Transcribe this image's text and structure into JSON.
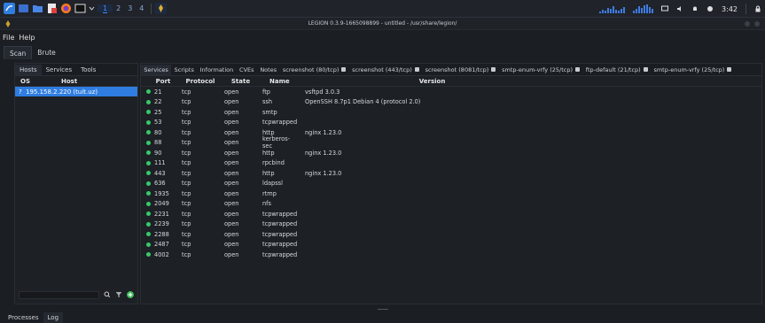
{
  "taskbar": {
    "workspaces": [
      "1",
      "2",
      "3",
      "4"
    ],
    "active_workspace": "1",
    "clock": "3:42",
    "app_icons": [
      "kali-menu-icon",
      "show-desktop-icon",
      "file-manager-icon",
      "text-editor-icon",
      "firefox-icon",
      "terminal-icon",
      "dropdown-icon"
    ]
  },
  "window": {
    "title": "LEGION 0.3.9-1665098899 - untitled - /usr/share/legion/"
  },
  "menubar": {
    "file": "File",
    "help": "Help"
  },
  "mode_tabs": {
    "scan": "Scan",
    "brute": "Brute"
  },
  "left_panel": {
    "tabs": [
      "Hosts",
      "Services",
      "Tools"
    ],
    "columns": {
      "os": "OS",
      "host": "Host"
    },
    "hosts": [
      {
        "os": "?",
        "host": "195.158.2.220 (tuit.uz)"
      }
    ]
  },
  "right_panel": {
    "tabs": [
      {
        "label": "Services",
        "closable": false
      },
      {
        "label": "Scripts",
        "closable": false
      },
      {
        "label": "Information",
        "closable": false
      },
      {
        "label": "CVEs",
        "closable": false
      },
      {
        "label": "Notes",
        "closable": false
      },
      {
        "label": "screenshot (80/tcp)",
        "closable": true
      },
      {
        "label": "screenshot (443/tcp)",
        "closable": true
      },
      {
        "label": "screenshot (8081/tcp)",
        "closable": true
      },
      {
        "label": "smtp-enum-vrfy (25/tcp)",
        "closable": true
      },
      {
        "label": "ftp-default (21/tcp)",
        "closable": true
      },
      {
        "label": "smtp-enum-vrfy (25/tcp)",
        "closable": true
      }
    ],
    "columns": {
      "port": "Port",
      "protocol": "Protocol",
      "state": "State",
      "name": "Name",
      "version": "Version"
    },
    "services": [
      {
        "port": "21",
        "protocol": "tcp",
        "state": "open",
        "name": "ftp",
        "version": "vsftpd 3.0.3"
      },
      {
        "port": "22",
        "protocol": "tcp",
        "state": "open",
        "name": "ssh",
        "version": "OpenSSH 8.7p1 Debian 4 (protocol 2.0)"
      },
      {
        "port": "25",
        "protocol": "tcp",
        "state": "open",
        "name": "smtp",
        "version": ""
      },
      {
        "port": "53",
        "protocol": "tcp",
        "state": "open",
        "name": "tcpwrapped",
        "version": ""
      },
      {
        "port": "80",
        "protocol": "tcp",
        "state": "open",
        "name": "http",
        "version": "nginx 1.23.0"
      },
      {
        "port": "88",
        "protocol": "tcp",
        "state": "open",
        "name": "kerberos-sec",
        "version": ""
      },
      {
        "port": "90",
        "protocol": "tcp",
        "state": "open",
        "name": "http",
        "version": "nginx 1.23.0"
      },
      {
        "port": "111",
        "protocol": "tcp",
        "state": "open",
        "name": "rpcbind",
        "version": ""
      },
      {
        "port": "443",
        "protocol": "tcp",
        "state": "open",
        "name": "http",
        "version": "nginx 1.23.0"
      },
      {
        "port": "636",
        "protocol": "tcp",
        "state": "open",
        "name": "ldapssl",
        "version": ""
      },
      {
        "port": "1935",
        "protocol": "tcp",
        "state": "open",
        "name": "rtmp",
        "version": ""
      },
      {
        "port": "2049",
        "protocol": "tcp",
        "state": "open",
        "name": "nfs",
        "version": ""
      },
      {
        "port": "2231",
        "protocol": "tcp",
        "state": "open",
        "name": "tcpwrapped",
        "version": ""
      },
      {
        "port": "2239",
        "protocol": "tcp",
        "state": "open",
        "name": "tcpwrapped",
        "version": ""
      },
      {
        "port": "2288",
        "protocol": "tcp",
        "state": "open",
        "name": "tcpwrapped",
        "version": ""
      },
      {
        "port": "2487",
        "protocol": "tcp",
        "state": "open",
        "name": "tcpwrapped",
        "version": ""
      },
      {
        "port": "4002",
        "protocol": "tcp",
        "state": "open",
        "name": "tcpwrapped",
        "version": ""
      }
    ]
  },
  "bottom_tabs": [
    "Processes",
    "Log"
  ],
  "colors": {
    "accent": "#2f7de0",
    "open_dot": "#35c96a",
    "background": "#1b1e22"
  }
}
